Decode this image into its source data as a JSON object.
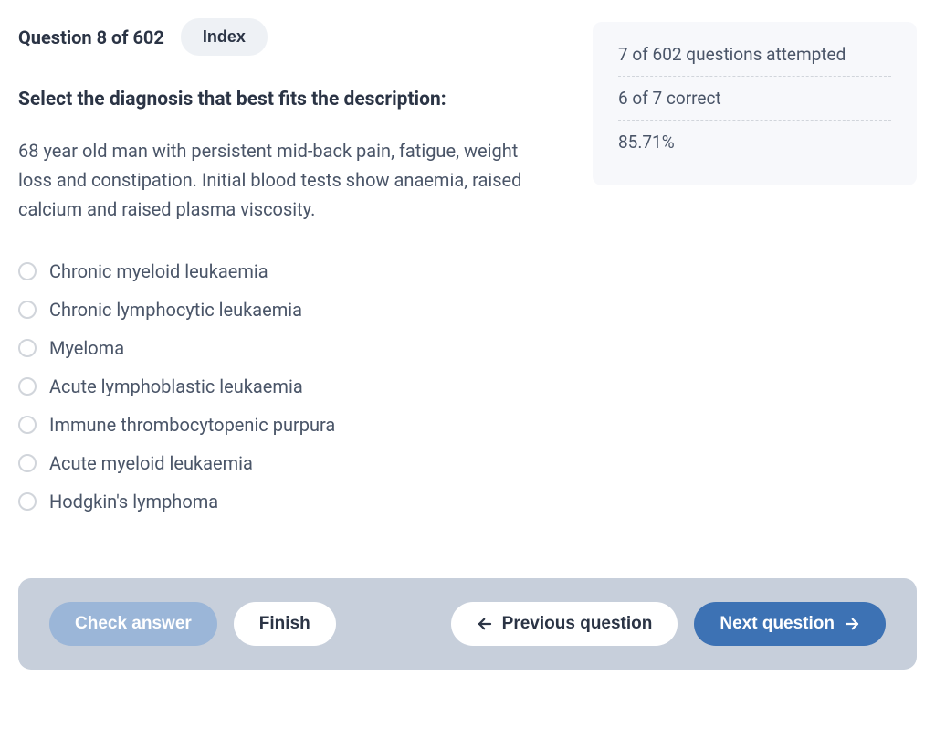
{
  "header": {
    "counter": "Question 8 of 602",
    "index_label": "Index"
  },
  "question": {
    "title": "Select the diagnosis that best fits the description:",
    "body": "68 year old man with persistent mid-back pain, fatigue, weight loss and constipation. Initial blood tests show anaemia, raised calcium and raised plasma viscosity."
  },
  "options": [
    "Chronic myeloid leukaemia",
    "Chronic lymphocytic leukaemia",
    "Myeloma",
    "Acute lymphoblastic leukaemia",
    "Immune thrombocytopenic purpura",
    "Acute myeloid leukaemia",
    "Hodgkin's lymphoma"
  ],
  "stats": {
    "attempted": "7 of 602 questions attempted",
    "correct": "6 of 7 correct",
    "percent": "85.71%"
  },
  "footer": {
    "check": "Check answer",
    "finish": "Finish",
    "prev": "Previous question",
    "next": "Next question"
  }
}
